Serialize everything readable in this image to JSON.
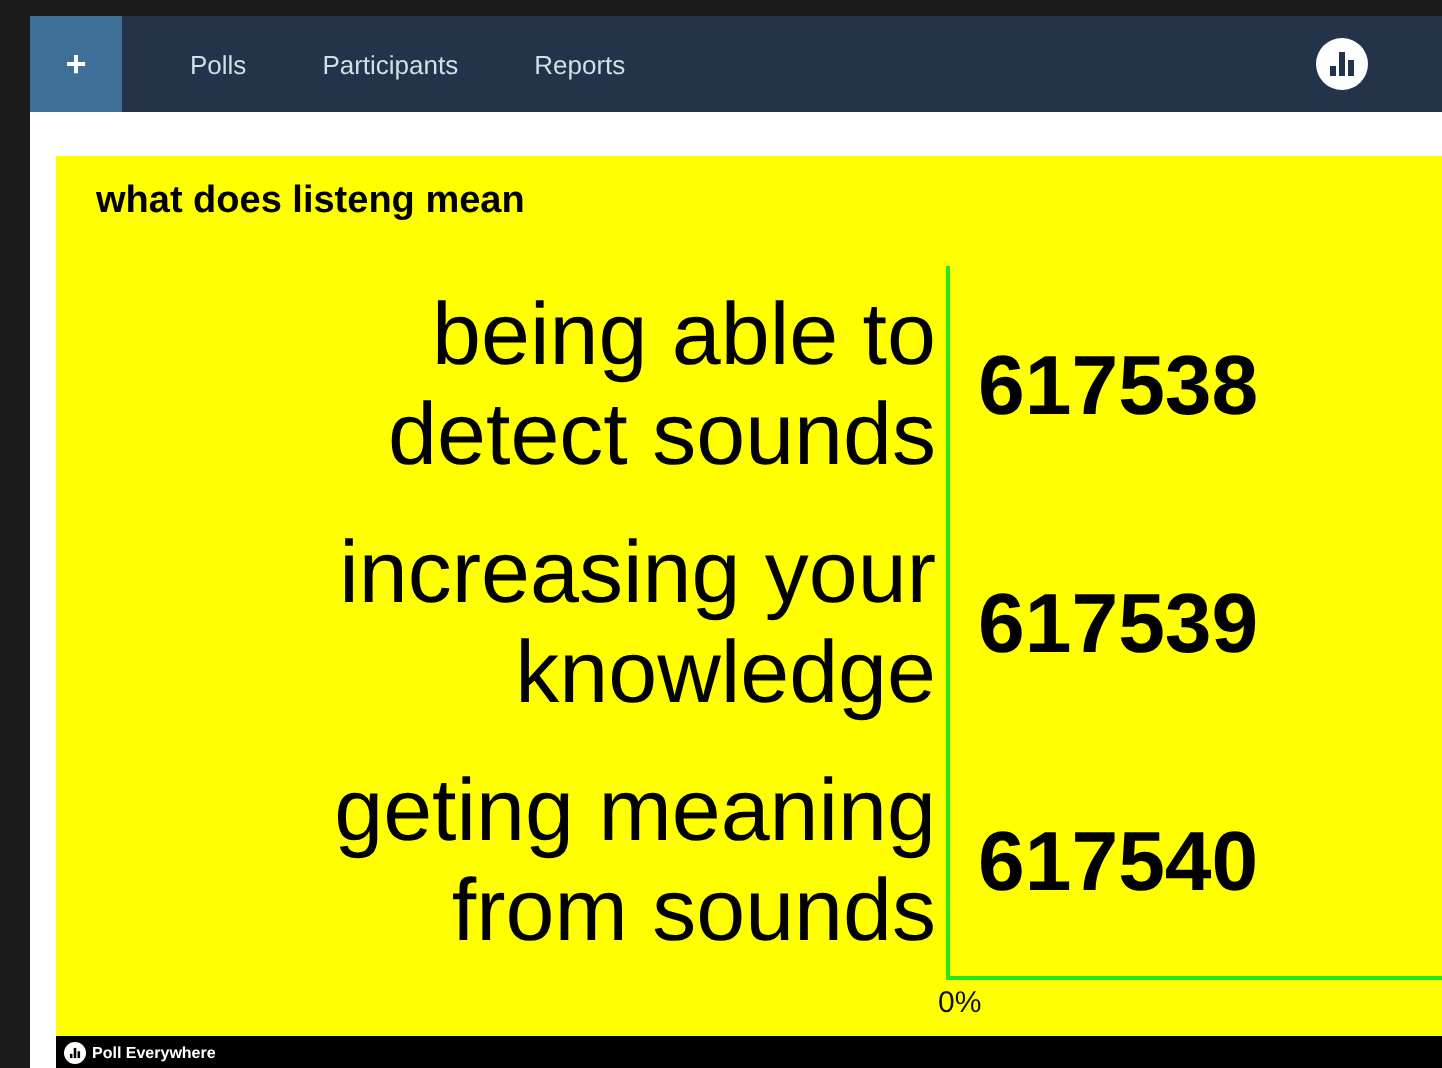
{
  "nav": {
    "add_button": "+",
    "items": [
      {
        "label": "Polls"
      },
      {
        "label": "Participants"
      },
      {
        "label": "Reports"
      }
    ]
  },
  "poll": {
    "question": "what does listeng mean",
    "answers": [
      {
        "label": "being able to detect sounds",
        "code": "617538"
      },
      {
        "label": "increasing your knowledge",
        "code": "617539"
      },
      {
        "label": "geting meaning from sounds",
        "code": "617540"
      }
    ],
    "axis_label": "0%"
  },
  "footer": {
    "brand": "Poll Everywhere"
  }
}
